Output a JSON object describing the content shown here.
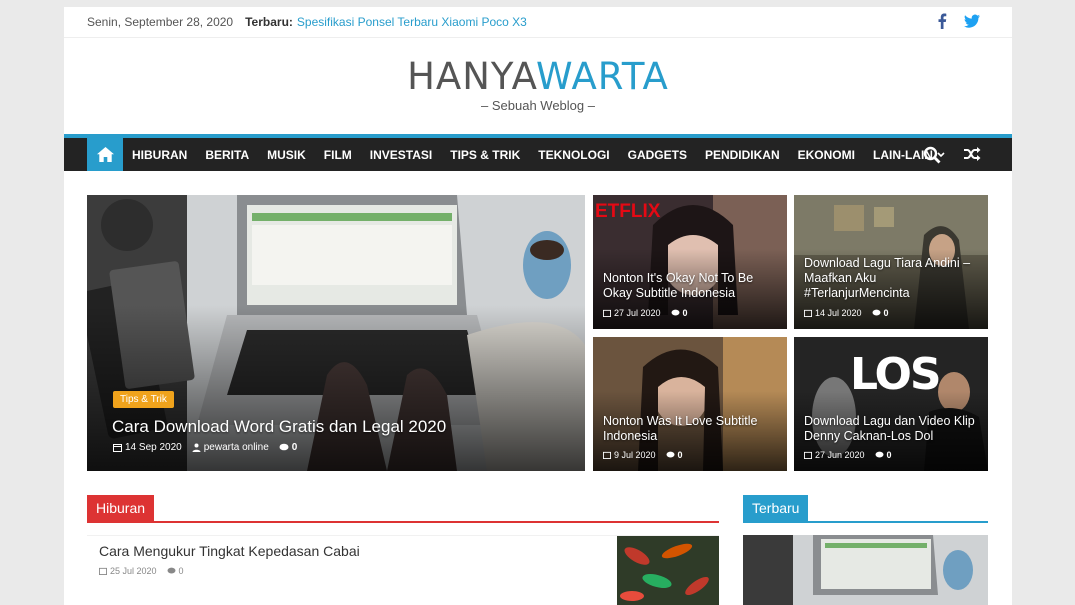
{
  "topbar": {
    "date": "Senin, September 28, 2020",
    "terbaru_label": "Terbaru:",
    "breaking": "Spesifikasi Ponsel Terbaru Xiaomi Poco X3"
  },
  "site": {
    "logo_part1": "HANYA",
    "logo_part2": "WARTA",
    "tagline": "– Sebuah Weblog –"
  },
  "nav": {
    "items": [
      "HIBURAN",
      "BERITA",
      "MUSIK",
      "FILM",
      "INVESTASI",
      "TIPS & TRIK",
      "TEKNOLOGI",
      "GADGETS",
      "PENDIDIKAN",
      "EKONOMI"
    ],
    "more": "LAIN-LAIN"
  },
  "featured": {
    "main": {
      "badge": "Tips & Trik",
      "title": "Cara Download Word Gratis dan Legal 2020",
      "date": "14 Sep 2020",
      "author": "pewarta online",
      "comments": "0"
    },
    "small": [
      {
        "title": "Nonton It's Okay Not To Be Okay Subtitle Indonesia",
        "date": "27 Jul 2020",
        "comments": "0",
        "overlay": "ETFLIX"
      },
      {
        "title": "Download Lagu Tiara Andini – Maafkan Aku #TerlanjurMencinta",
        "date": "14 Jul 2020",
        "comments": "0"
      },
      {
        "title": "Nonton Was It Love Subtitle Indonesia",
        "date": "9 Jul 2020",
        "comments": "0"
      },
      {
        "title": "Download Lagu dan Video Klip Denny Caknan-Los Dol",
        "date": "27 Jun 2020",
        "comments": "0",
        "overlay": "LOS"
      }
    ]
  },
  "hiburan": {
    "heading": "Hiburan",
    "post_title": "Cara Mengukur Tingkat Kepedasan Cabai",
    "post_date": "25 Jul 2020",
    "post_comments": "0"
  },
  "terbaru": {
    "heading": "Terbaru"
  },
  "colors": {
    "accent": "#289dcc",
    "hiburan": "#dd3333",
    "badge": "#f0a31c",
    "nav_bg": "#232323"
  }
}
